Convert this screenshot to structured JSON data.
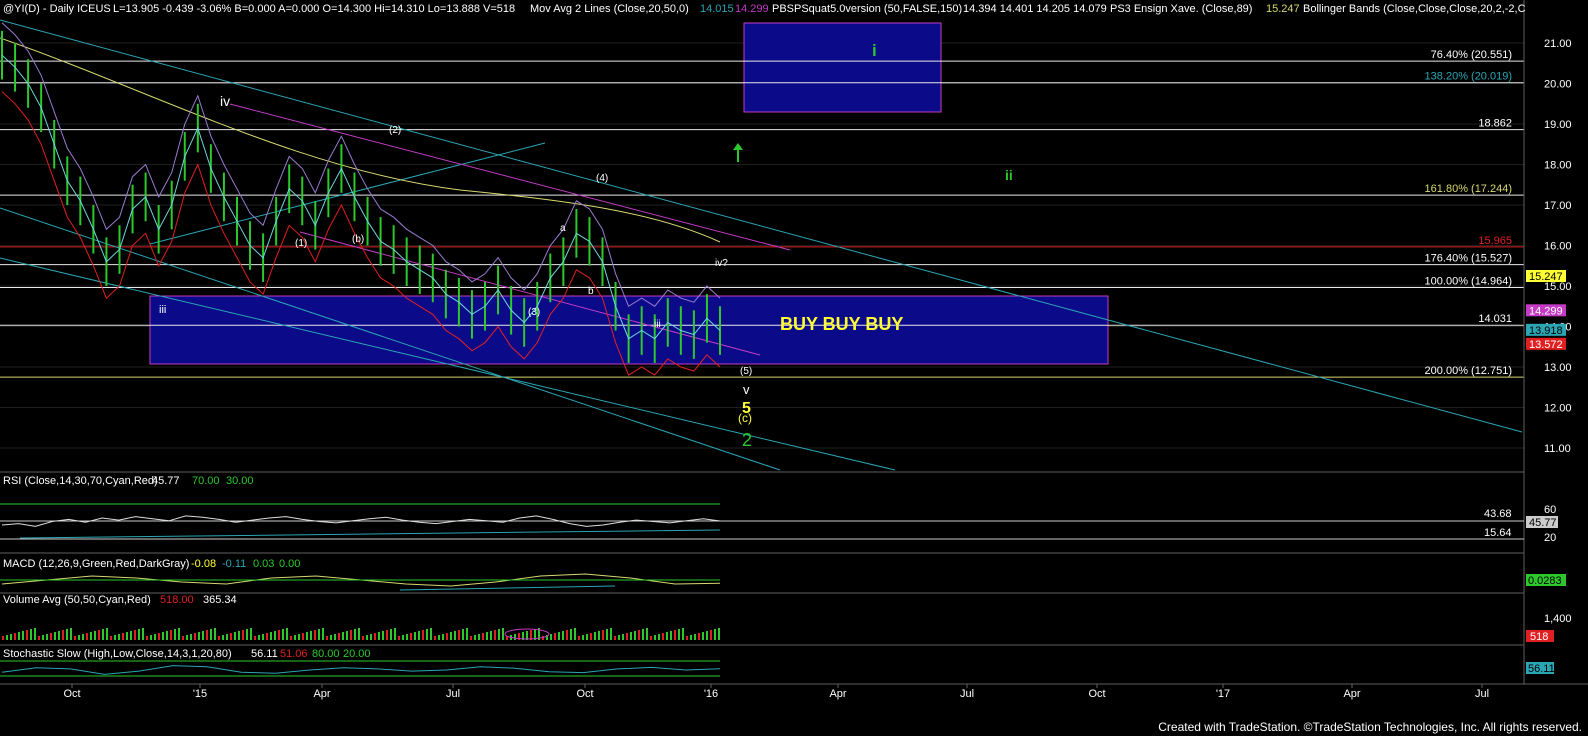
{
  "header": {
    "symbol": "@YI(D) - Daily  ICEUS",
    "quote": "L=13.905  -0.439  -3.06%  B=0.000  A=0.000  O=14.300  Hi=14.310  Lo=13.888  V=518",
    "mav_name": "Mov Avg 2 Lines (Close,20,50,0)",
    "mav_v1": "14.015",
    "mav_v2": "14.299",
    "squat_name": "PBSPSquat5.0version (50,FALSE,150)",
    "squat_values": "14.394  14.401  14.205  14.079",
    "ensign_name": "PS3 Ensign Xave. (Close,89)",
    "ensign_value": "15.247",
    "bb_name": "Bollinger Bands (Close,Close,Close,20,2,-2,C"
  },
  "colors": {
    "background": "#000000",
    "grid": "#1f1f1f",
    "channel": "#2aa6b5",
    "magenta": "#c43bc4",
    "box": "#0b0b8a",
    "yellow_line": "#d8d870",
    "red": "#e02020",
    "green": "#2cc82c",
    "label_yellow": "#ffff33",
    "panel_sep": "#606060"
  },
  "chart_data": [
    {
      "type": "line",
      "panel": "price",
      "title": "@YI(D) - Daily",
      "ylim": [
        10.6,
        21.6
      ],
      "y_ticks": [
        11.0,
        12.0,
        13.0,
        14.0,
        15.0,
        16.0,
        17.0,
        18.0,
        19.0,
        20.0,
        21.0
      ],
      "x_ticks": [
        "Oct",
        "'15",
        "Apr",
        "Jul",
        "Oct",
        "'16",
        "Apr",
        "Jul",
        "Oct",
        "'17",
        "Apr",
        "Jul"
      ],
      "series": [
        {
          "values": [
            20.7,
            20.4,
            20.0,
            19.4,
            18.5,
            17.6,
            17.1,
            16.4,
            15.6,
            15.9,
            16.9,
            17.2,
            16.4,
            17.0,
            18.2,
            18.9,
            17.9,
            17.2,
            16.6,
            16.0,
            15.7,
            16.6,
            17.4,
            17.1,
            16.5,
            17.3,
            17.9,
            17.2,
            16.6,
            16.1,
            15.9,
            15.6,
            15.4,
            15.2,
            14.8,
            14.6,
            14.3,
            14.5,
            14.9,
            14.4,
            14.1,
            14.5,
            15.2,
            15.6,
            16.3,
            16.1,
            15.6,
            14.5,
            13.7,
            13.9,
            13.7,
            14.1,
            13.9,
            13.8,
            14.2,
            13.9
          ]
        }
      ],
      "horizontal_levels": [
        {
          "label": "76.40% (20.551)",
          "value": 20.551
        },
        {
          "label": "138.20% (20.019)",
          "value": 20.019
        },
        {
          "label": "18.862",
          "value": 18.862
        },
        {
          "label": "161.80% (17.244)",
          "value": 17.244
        },
        {
          "label": "15.965",
          "value": 15.965
        },
        {
          "label": "176.40% (15.527)",
          "value": 15.527
        },
        {
          "label": "100.00% (14.964)",
          "value": 14.964
        },
        {
          "label": "14.031",
          "value": 14.031
        },
        {
          "label": "200.00% (12.751)",
          "value": 12.751
        }
      ],
      "price_badges": [
        {
          "label": "15.247",
          "value": 15.247,
          "color": "#ffff33",
          "text_color": "#000000"
        },
        {
          "label": "14.299",
          "value": 14.4,
          "color": "#c43bc4",
          "text_color": "#ffffff"
        },
        {
          "label": "13.918",
          "value": 13.918,
          "color": "#2aa6b5",
          "text_color": "#000000"
        },
        {
          "label": "13.572",
          "value": 13.572,
          "color": "#e02020",
          "text_color": "#ffffff"
        }
      ],
      "wave_labels": [
        "iv",
        "(2)",
        "(4)",
        "(1)",
        "(b)",
        "(3)",
        "a",
        "b",
        "iii",
        "iii",
        "iv?",
        "(5)",
        "v",
        "5",
        "(c)",
        "2",
        "i",
        "ii"
      ],
      "annotations": [
        "BUY BUY BUY"
      ]
    },
    {
      "type": "line",
      "panel": "rsi",
      "title": "RSI (Close,14,30,70,Cyan,Red)",
      "values_text": [
        "45.77",
        "70.00",
        "30.00"
      ],
      "ylim": [
        0,
        100
      ],
      "y_ticks": [
        20.0,
        60.0
      ],
      "levels": [
        {
          "label": "43.68",
          "value": 43.68
        },
        {
          "label": "15.64",
          "value": 15.64
        }
      ],
      "badge": "45.77",
      "series": [
        {
          "values": [
            40,
            42,
            38,
            45,
            48,
            44,
            50,
            47,
            52,
            49,
            46,
            53,
            51,
            48,
            44,
            47,
            50,
            52,
            48,
            45,
            43,
            46,
            49,
            51,
            47,
            44,
            42,
            45,
            48,
            46,
            44,
            50,
            53,
            48,
            42,
            38,
            40,
            44,
            47,
            45,
            43,
            46,
            49,
            45.77
          ]
        }
      ]
    },
    {
      "type": "line",
      "panel": "macd",
      "title": "MACD (12,26,9,Green,Red,DarkGray)",
      "values_text": [
        "-0.08",
        "-0.11",
        "0.03",
        "0.00"
      ],
      "badge": "0.0283",
      "series": [
        {
          "values": [
            -0.1,
            0.0,
            0.1,
            0.05,
            -0.05,
            -0.1,
            0.05,
            0.1,
            0.0,
            -0.1,
            -0.15,
            -0.05,
            0.1,
            0.15,
            0.05,
            -0.1,
            -0.08
          ]
        }
      ]
    },
    {
      "type": "bar",
      "panel": "volume",
      "title": "Volume Avg (50,50,Cyan,Red)",
      "values_text": [
        "518.00",
        "365.34"
      ],
      "y_ticks": [
        1400
      ],
      "tick_labels": [
        "1,400"
      ],
      "badge": "518"
    },
    {
      "type": "line",
      "panel": "stochastic",
      "title": "Stochastic Slow (High,Low,Close,14,3,1,20,80)",
      "values_text": [
        "56.11",
        "51.06",
        "80.00",
        "20.00"
      ],
      "badge": "56.11",
      "series": [
        {
          "values": [
            40,
            60,
            55,
            30,
            45,
            70,
            65,
            40,
            35,
            50,
            60,
            55,
            45,
            50,
            65,
            58,
            42,
            38,
            55,
            62,
            50,
            56
          ]
        }
      ]
    }
  ],
  "footer": "Created with TradeStation. ©TradeStation Technologies, Inc. All rights reserved."
}
